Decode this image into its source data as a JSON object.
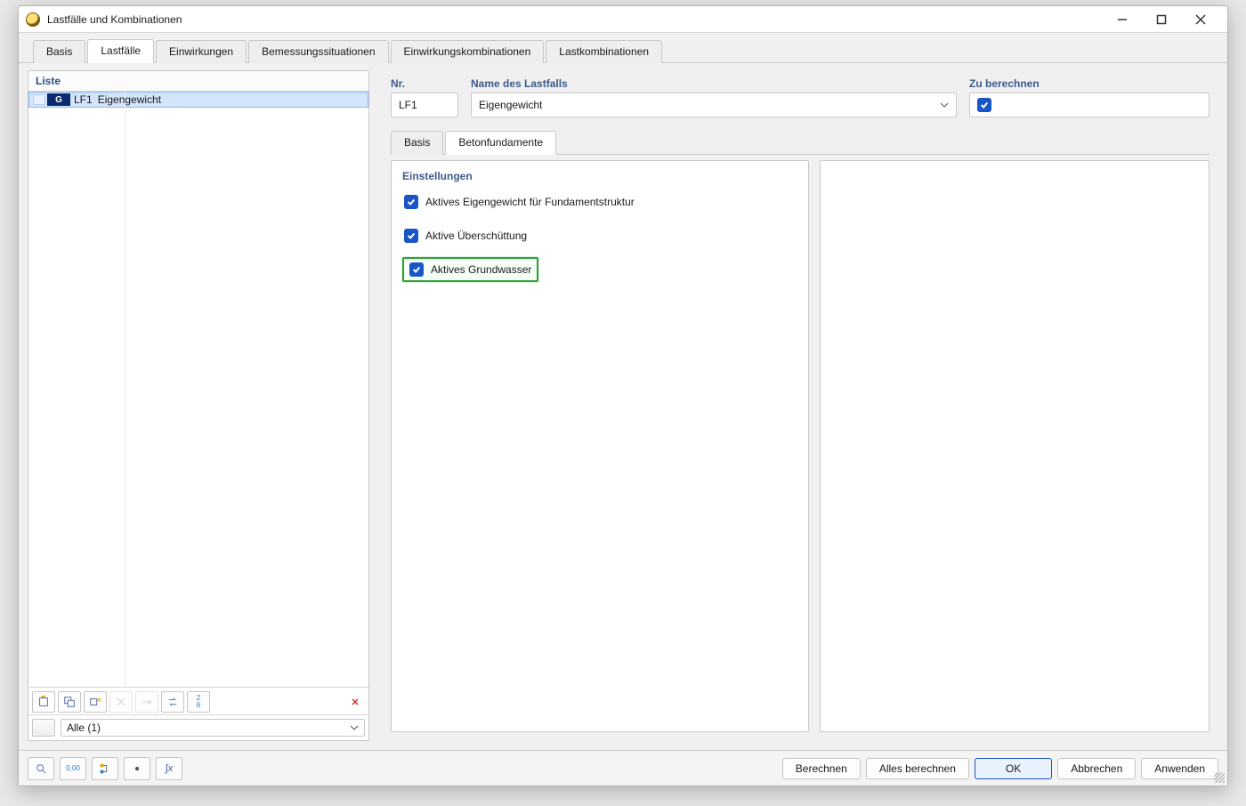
{
  "window": {
    "title": "Lastfälle und Kombinationen"
  },
  "tabs": {
    "basis": "Basis",
    "lastfaelle": "Lastfälle",
    "einwirkungen": "Einwirkungen",
    "bemessung": "Bemessungssituationen",
    "einwkomb": "Einwirkungskombinationen",
    "lastkomb": "Lastkombinationen"
  },
  "left": {
    "header": "Liste",
    "row": {
      "badge": "G",
      "code": "LF1",
      "name": "Eigengewicht"
    },
    "filter": "Alle (1)"
  },
  "header": {
    "nr_label": "Nr.",
    "nr_value": "LF1",
    "name_label": "Name des Lastfalls",
    "name_value": "Eigengewicht",
    "zu_label": "Zu berechnen"
  },
  "subtabs": {
    "basis": "Basis",
    "beton": "Betonfundamente"
  },
  "settings": {
    "section_title": "Einstellungen",
    "opt1": "Aktives Eigengewicht für Fundamentstruktur",
    "opt2": "Aktive Überschüttung",
    "opt3": "Aktives Grundwasser"
  },
  "bottom": {
    "berechnen": "Berechnen",
    "alles": "Alles berechnen",
    "ok": "OK",
    "abbrechen": "Abbrechen",
    "anwenden": "Anwenden"
  }
}
